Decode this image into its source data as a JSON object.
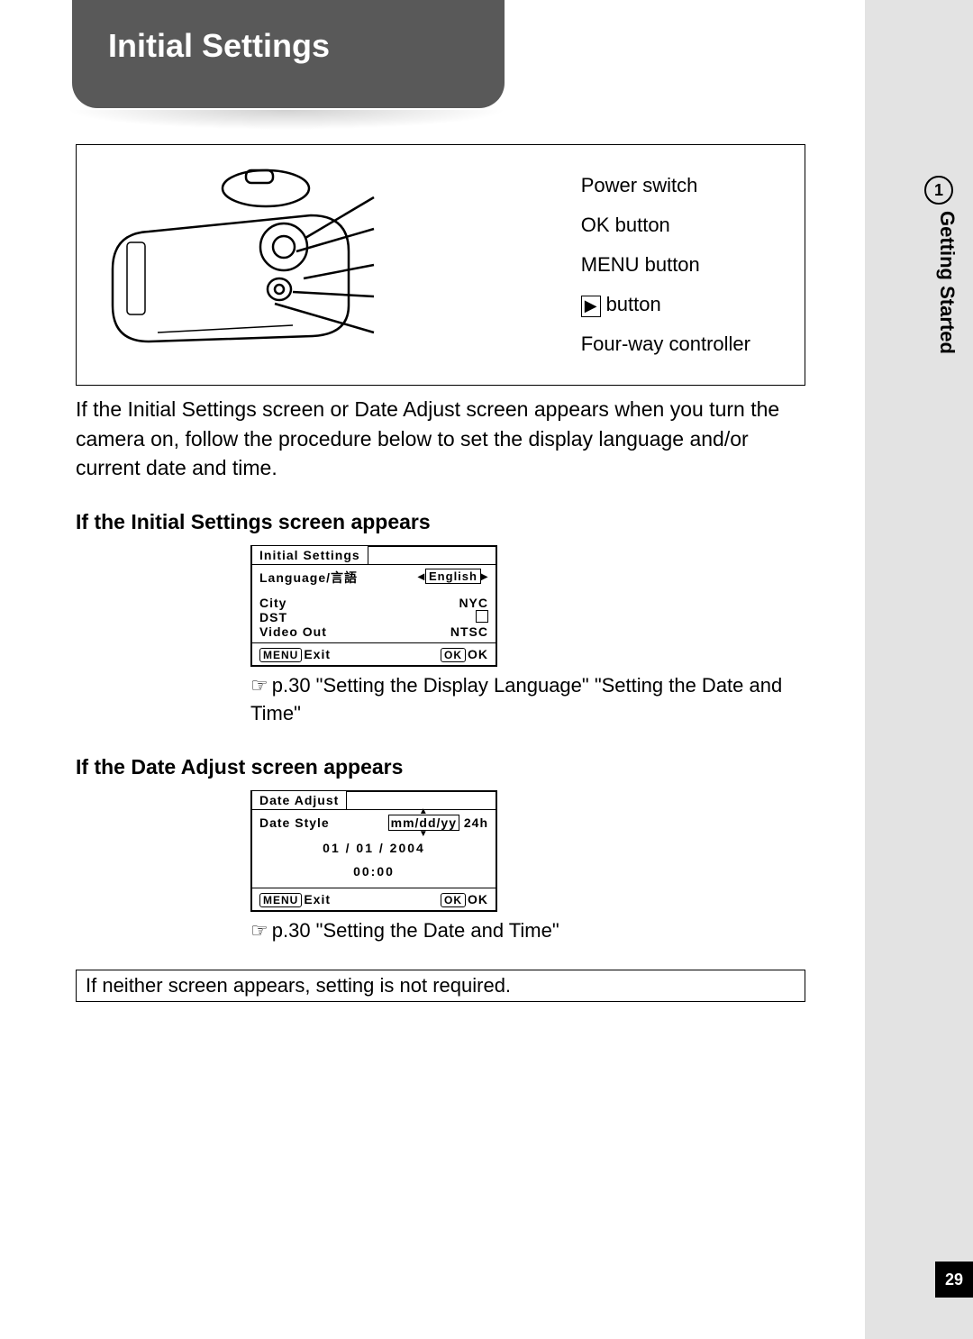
{
  "page": {
    "title": "Initial Settings",
    "section_number": "1",
    "section_name": "Getting Started",
    "page_number": "29"
  },
  "diagram": {
    "callouts": [
      "Power switch",
      "OK button",
      "MENU button",
      "button",
      "Four-way controller"
    ]
  },
  "intro_paragraph": "If the Initial Settings screen or Date Adjust screen appears when you turn the camera on, follow the procedure below to set the display language and/or current date and time.",
  "subsection1": {
    "heading": "If the Initial Settings screen appears",
    "lcd": {
      "title": "Initial Settings",
      "rows": {
        "language_label": "Language/言語",
        "language_value": "English",
        "city_label": "City",
        "city_value": "NYC",
        "dst_label": "DST",
        "video_label": "Video Out",
        "video_value": "NTSC"
      },
      "footer": {
        "menu": "MENU",
        "exit": "Exit",
        "ok": "OK",
        "ok2": "OK"
      }
    },
    "reference": "p.30 \"Setting the Display Language\" \"Setting the Date and Time\""
  },
  "subsection2": {
    "heading": "If the Date Adjust screen appears",
    "lcd": {
      "title": "Date Adjust",
      "style_label": "Date Style",
      "style_value": "mm/dd/yy",
      "hour_mode": "24h",
      "date": "01 / 01 / 2004",
      "time": "00:00",
      "footer": {
        "menu": "MENU",
        "exit": "Exit",
        "ok": "OK",
        "ok2": "OK"
      }
    },
    "reference": "p.30 \"Setting the Date and Time\""
  },
  "note": "If neither screen appears, setting is not required."
}
